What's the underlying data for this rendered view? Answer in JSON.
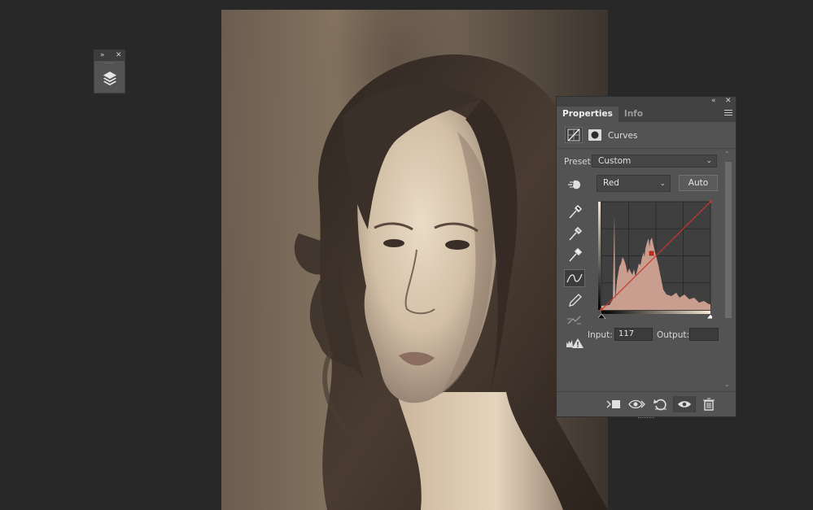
{
  "mini_panel": {
    "expand_glyph": "»",
    "close_glyph": "✕",
    "icon": "layers-icon"
  },
  "panel": {
    "collapse_glyph": "«",
    "close_glyph": "✕",
    "tabs": [
      {
        "label": "Properties",
        "active": true
      },
      {
        "label": "Info",
        "active": false
      }
    ],
    "header_title": "Curves",
    "preset_label": "Preset:",
    "preset_value": "Custom",
    "channel_value": "Red",
    "auto_label": "Auto",
    "input_label": "Input:",
    "input_value": "117",
    "output_label": "Output:",
    "output_value": ""
  },
  "tools": [
    "on-image-adjust-icon",
    "black-point-eyedropper-icon",
    "gray-point-eyedropper-icon",
    "white-point-eyedropper-icon",
    "curve-edit-points-icon",
    "pencil-draw-icon",
    "smooth-curve-icon",
    "clipping-warning-icon"
  ],
  "footer_icons": [
    "clip-to-layer-icon",
    "view-previous-state-icon",
    "reset-icon",
    "visibility-eye-icon",
    "trash-icon"
  ],
  "colors": {
    "panel_bg": "#535353",
    "curve_red": "#c8372d",
    "histogram": "#d8a898",
    "app_bg": "#282828"
  }
}
